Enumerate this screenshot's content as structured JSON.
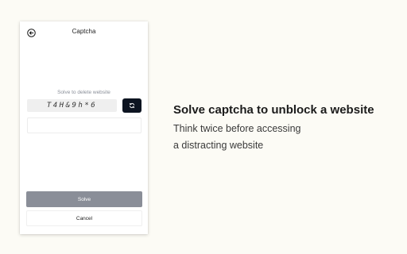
{
  "popup": {
    "title": "Captcha",
    "prompt": "Solve to delete website",
    "captcha_text": "T4H&9h*6",
    "answer_value": "",
    "answer_placeholder": "",
    "solve_label": "Solve",
    "cancel_label": "Cancel",
    "icons": {
      "back": "arrow-left-circle-icon",
      "refresh": "refresh-icon"
    }
  },
  "promo": {
    "headline": "Solve captcha to unblock a website",
    "subline_1": "Think twice before accessing",
    "subline_2": "a distracting website"
  },
  "colors": {
    "background": "#fcfbf5",
    "refresh_button": "#0d1421",
    "solve_button": "#8a8e98"
  }
}
